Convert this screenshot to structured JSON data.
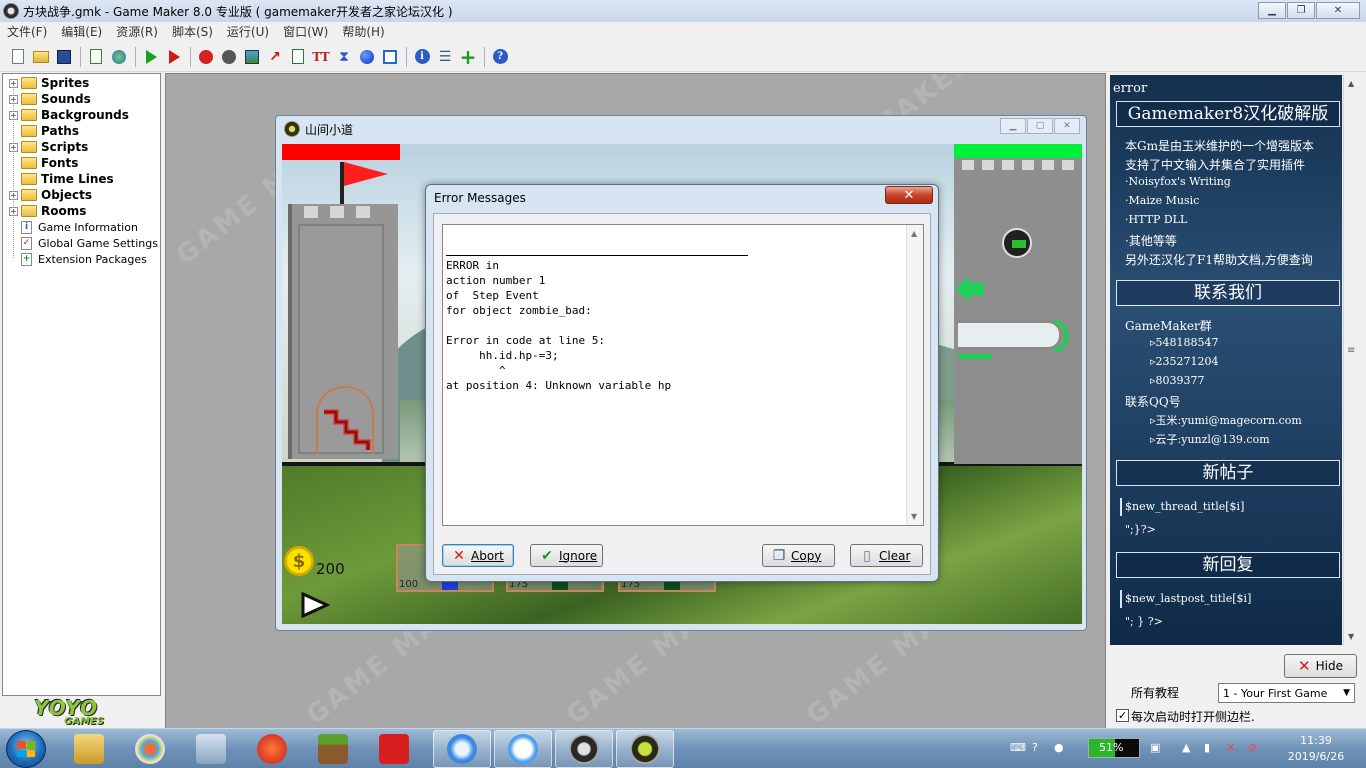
{
  "window": {
    "title": "方块战争.gmk - Game Maker 8.0 专业版 ( gamemaker开发者之家论坛汉化 )"
  },
  "menu": [
    "文件(F)",
    "编辑(E)",
    "资源(R)",
    "脚本(S)",
    "运行(U)",
    "窗口(W)",
    "帮助(H)"
  ],
  "toolbar_icons": [
    "new-file-icon",
    "open-folder-icon",
    "save-disk-icon",
    "publish-icon",
    "web-globe-icon",
    "run-icon",
    "run-debug-icon",
    "add-sprite-icon",
    "add-sound-icon",
    "add-background-icon",
    "add-path-icon",
    "add-script-icon",
    "add-font-icon",
    "add-timeline-icon",
    "add-object-icon",
    "add-room-icon",
    "game-info-icon",
    "global-settings-icon",
    "extension-icon",
    "help-icon"
  ],
  "tree": {
    "folders": [
      "Sprites",
      "Sounds",
      "Backgrounds",
      "Paths",
      "Scripts",
      "Fonts",
      "Time Lines",
      "Objects",
      "Rooms"
    ],
    "leaves": [
      "Game Information",
      "Global Game Settings",
      "Extension Packages"
    ]
  },
  "logo": {
    "top": "YOYO",
    "bottom": "GAMES"
  },
  "watermark": "GAME MAKER",
  "game_window": {
    "title": "山间小道",
    "money": "200",
    "unit_costs": [
      "100",
      "175",
      "175"
    ]
  },
  "error_dialog": {
    "title": "Error Messages",
    "close_glyph": "✕",
    "message": "ERROR in\naction number 1\nof  Step Event\nfor object zombie_bad:\n\nError in code at line 5:\n     hh.id.hp-=3;\n        ^\nat position 4: Unknown variable hp",
    "buttons": {
      "abort": "Abort",
      "ignore": "Ignore",
      "copy": "Copy",
      "clear": "Clear"
    }
  },
  "right_panel": {
    "error_label": "error",
    "heading": "Gamemaker8汉化破解版",
    "intro_lines": [
      "本Gm是由玉米维护的一个增强版本",
      "支持了中文输入并集合了实用插件",
      "·Noisyfox's Writing",
      "·Maize Music",
      "·HTTP DLL",
      "·其他等等",
      "另外还汉化了F1帮助文档,方便查询"
    ],
    "contact_heading": "联系我们",
    "group_label": "GameMaker群",
    "groups": [
      "▹548188547",
      "▹235271204",
      "▹8039377"
    ],
    "qq_label": "联系QQ号",
    "qqs": [
      "▹玉米:yumi@magecorn.com",
      "▹云子:yunzl@139.com"
    ],
    "new_thread_heading": "新帖子",
    "new_thread_var": "$new_thread_title[$i]",
    "new_thread_tail": "\";}?>",
    "new_reply_heading": "新回复",
    "new_reply_var": "$new_lastpost_title[$i]",
    "new_reply_tail": "\"; } ?>"
  },
  "hide_button": "Hide",
  "tutorial_label": "所有教程",
  "tutorial_selected": "1 - Your First Game",
  "startup_checkbox": {
    "label": "每次启动时打开侧边栏.",
    "checked": true
  },
  "taskbar": {
    "battery": "51%",
    "battery_level": 0.51,
    "time": "11:39",
    "date": "2019/6/26"
  },
  "colors": {
    "title_bg": "#dce6f4",
    "dialog_bg": "#d7e4f2",
    "panel_bg": "#1d3d5e",
    "hp_red": "#ff0000",
    "hp_green": "#00f03a"
  }
}
